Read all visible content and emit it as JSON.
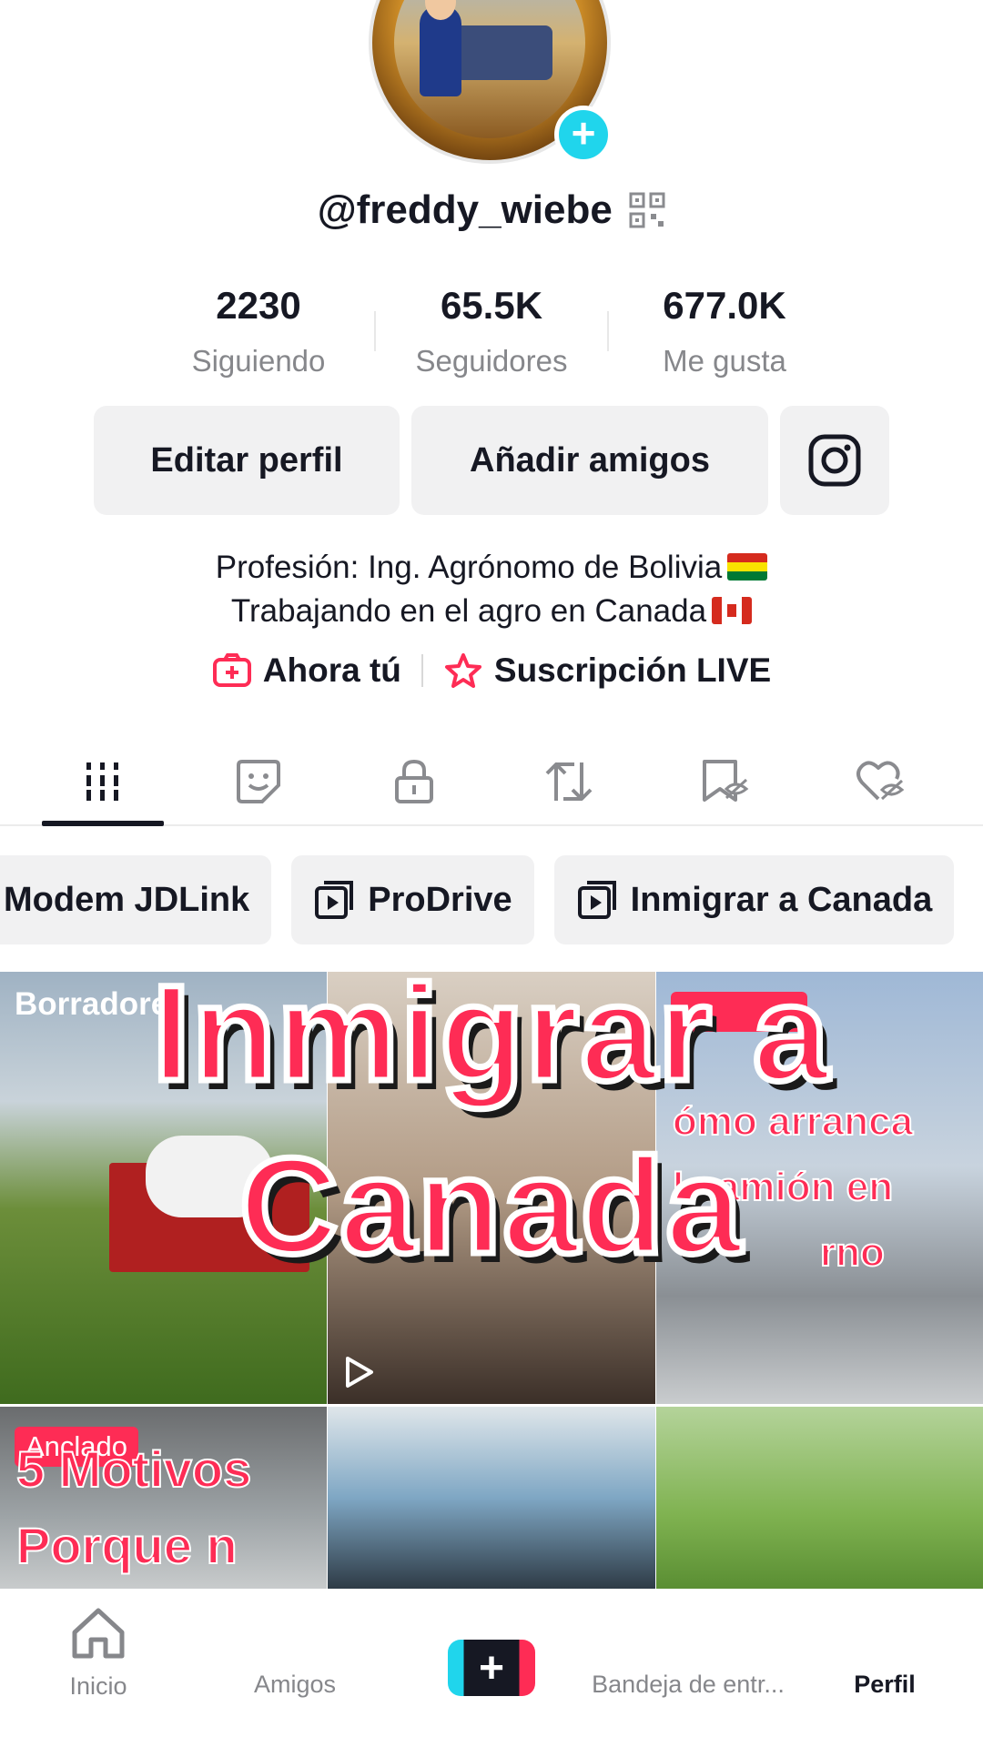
{
  "profile": {
    "username": "@freddy_wiebe",
    "stats": [
      {
        "value": "2230",
        "label": "Siguiendo"
      },
      {
        "value": "65.5K",
        "label": "Seguidores"
      },
      {
        "value": "677.0K",
        "label": "Me gusta"
      }
    ],
    "buttons": {
      "edit": "Editar perfil",
      "add_friends": "Añadir amigos"
    },
    "bio_lines": [
      "Profesión: Ing. Agrónomo de Bolivia",
      "Trabajando en el agro en Canada"
    ],
    "links": {
      "now_you": "Ahora tú",
      "subscription": "Suscripción LIVE"
    }
  },
  "tabs": [
    {
      "icon": "videos-grid-icon",
      "active": true
    },
    {
      "icon": "stickers-icon",
      "active": false
    },
    {
      "icon": "lock-icon",
      "active": false
    },
    {
      "icon": "repost-icon",
      "active": false
    },
    {
      "icon": "favorites-hidden-icon",
      "active": false
    },
    {
      "icon": "liked-hidden-icon",
      "active": false
    }
  ],
  "playlists": [
    "Modem JDLink",
    "ProDrive",
    "Inmigrar a Canada"
  ],
  "grid": {
    "drafts_label": "Borradore",
    "pinned_label": "Anclado",
    "cell3_text": "ómo arranca",
    "cell3_text2": "l camión en",
    "cell3_text3": "rno",
    "cell4_text": "5 Motivos",
    "cell4_text2": "Porque n"
  },
  "overlay": {
    "line1": "Inmigrar a",
    "line2": "Canada"
  },
  "nav": {
    "home": "Inicio",
    "friends": "Amigos",
    "inbox": "Bandeja de entr...",
    "profile": "Perfil"
  },
  "colors": {
    "accent": "#fe2c55",
    "teal": "#20d5ec",
    "text": "#161823",
    "muted": "#86878b"
  }
}
